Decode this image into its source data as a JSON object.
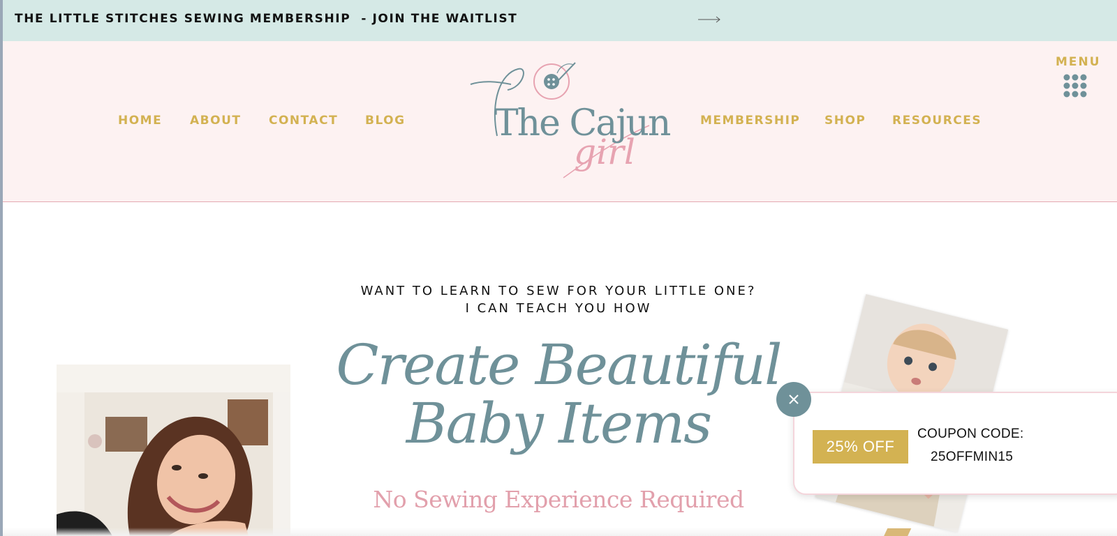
{
  "announcement": {
    "text": "THE LITTLE STITCHES SEWING MEMBERSHIP  - JOIN THE WAITLIST",
    "arrow_icon": "arrow-right-icon"
  },
  "nav": {
    "left": [
      "HOME",
      "ABOUT",
      "CONTACT",
      "BLOG"
    ],
    "right": [
      "MEMBERSHIP",
      "SHOP",
      "RESOURCES"
    ],
    "menu_label": "MENU",
    "menu_icon": "grid-dots-icon"
  },
  "logo": {
    "main": "The Cajun",
    "sub": "girl",
    "icon": "button-needle-icon"
  },
  "hero": {
    "kicker_line1": "WANT TO LEARN TO SEW FOR YOUR LITTLE ONE?",
    "kicker_line2": "I CAN TEACH YOU HOW",
    "headline_line1": "Create Beautiful",
    "headline_line2": "Baby Items",
    "subheadline": "No Sewing Experience Required"
  },
  "coupon": {
    "badge": "25% OFF",
    "label": "COUPON CODE:",
    "code": "25OFFMIN15",
    "close_icon": "close-icon"
  },
  "colors": {
    "announcement_bg": "#d5e9e6",
    "header_bg": "#fdf2f2",
    "gold": "#d3b252",
    "teal": "#6f9199",
    "pink": "#e2a0ac"
  }
}
